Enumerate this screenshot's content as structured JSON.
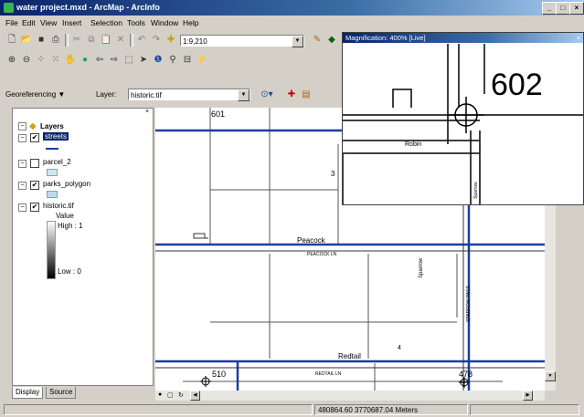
{
  "window": {
    "title": "water project.mxd - ArcMap - ArcInfo"
  },
  "menu": [
    "File",
    "Edit",
    "View",
    "Insert",
    "Selection",
    "Tools",
    "Window",
    "Help"
  ],
  "toolbar": {
    "scale": "1:9,210"
  },
  "georef": {
    "label": "Georeferencing ▼",
    "layer_label": "Layer:",
    "layer_value": "historic.tif"
  },
  "magnifier": {
    "title": "Magnification: 400% [Live]",
    "parcel_number": "602",
    "street_label": "Robin",
    "side_street": "Sparrow"
  },
  "toc": {
    "root": "Layers",
    "layers": [
      {
        "name": "streets",
        "checked": true,
        "selected": true
      },
      {
        "name": "parcel_2",
        "checked": false
      },
      {
        "name": "parks_polygon",
        "checked": true
      },
      {
        "name": "historic.tif",
        "checked": true
      }
    ],
    "raster_field": "Value",
    "high": "High : 1",
    "low": "Low : 0"
  },
  "tabs": {
    "display": "Display",
    "source": "Source"
  },
  "map_labels": {
    "parcel_601": "601",
    "parcel_510": "510",
    "parcel_478": "478",
    "street_peacock": "Peacock",
    "street_peacock_small": "PEACOCK LN",
    "street_redtail": "Redtail",
    "street_redtail_small": "REDTAIL LN",
    "street_sparrow": "Sparrow",
    "street_sparrow_small": "SPARROW PASS",
    "label_3": "3",
    "label_4": "4"
  },
  "status": {
    "coords": "480864.60  3770687.04 Meters"
  }
}
